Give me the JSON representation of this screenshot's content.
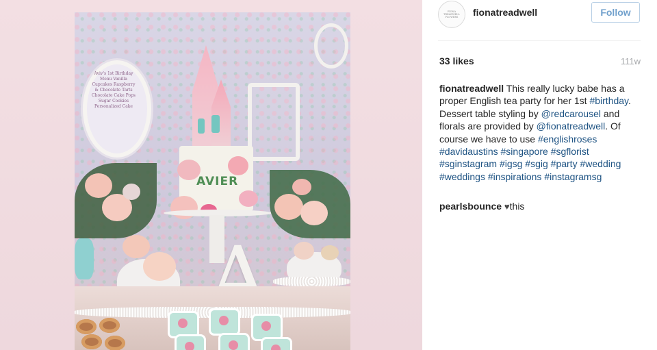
{
  "post": {
    "username": "fionatreadwell",
    "avatar_text": "FIONA TREADWELL FLOWERS",
    "follow_label": "Follow",
    "likes": "33 likes",
    "time": "111w",
    "photo": {
      "menu_text": "Aviv's 1st Birthday Menu Vanilla Cupcakes Raspberry & Chocolate Tarts Chocolate Cake Pops Sugar Cookies Personalized Cake",
      "cake_letters": "AVIER",
      "letter": "A"
    },
    "caption": {
      "username": "fionatreadwell",
      "parts": [
        " This really lucky babe has a proper English tea party for her 1st ",
        "#birthday",
        ". Dessert table styling by ",
        "@redcarousel",
        " and florals are provided by ",
        "@fionatreadwell",
        ". Of course we have to use ",
        "#englishroses",
        " ",
        "#davidaustins",
        " ",
        "#singapore",
        " ",
        "#sgflorist",
        " ",
        "#sginstagram",
        " ",
        "#igsg",
        " ",
        "#sgig",
        " ",
        "#party",
        " ",
        "#wedding",
        " ",
        "#weddings",
        " ",
        "#inspirations",
        " ",
        "#instagramsg"
      ]
    },
    "comment": {
      "username": "pearlsbounce",
      "icon": "heart-icon",
      "text": "this"
    }
  },
  "colors": {
    "link": "#1e5383",
    "follow": "#70a0cc",
    "time": "#a5a7aa",
    "background_left": "#f3dfe3"
  }
}
